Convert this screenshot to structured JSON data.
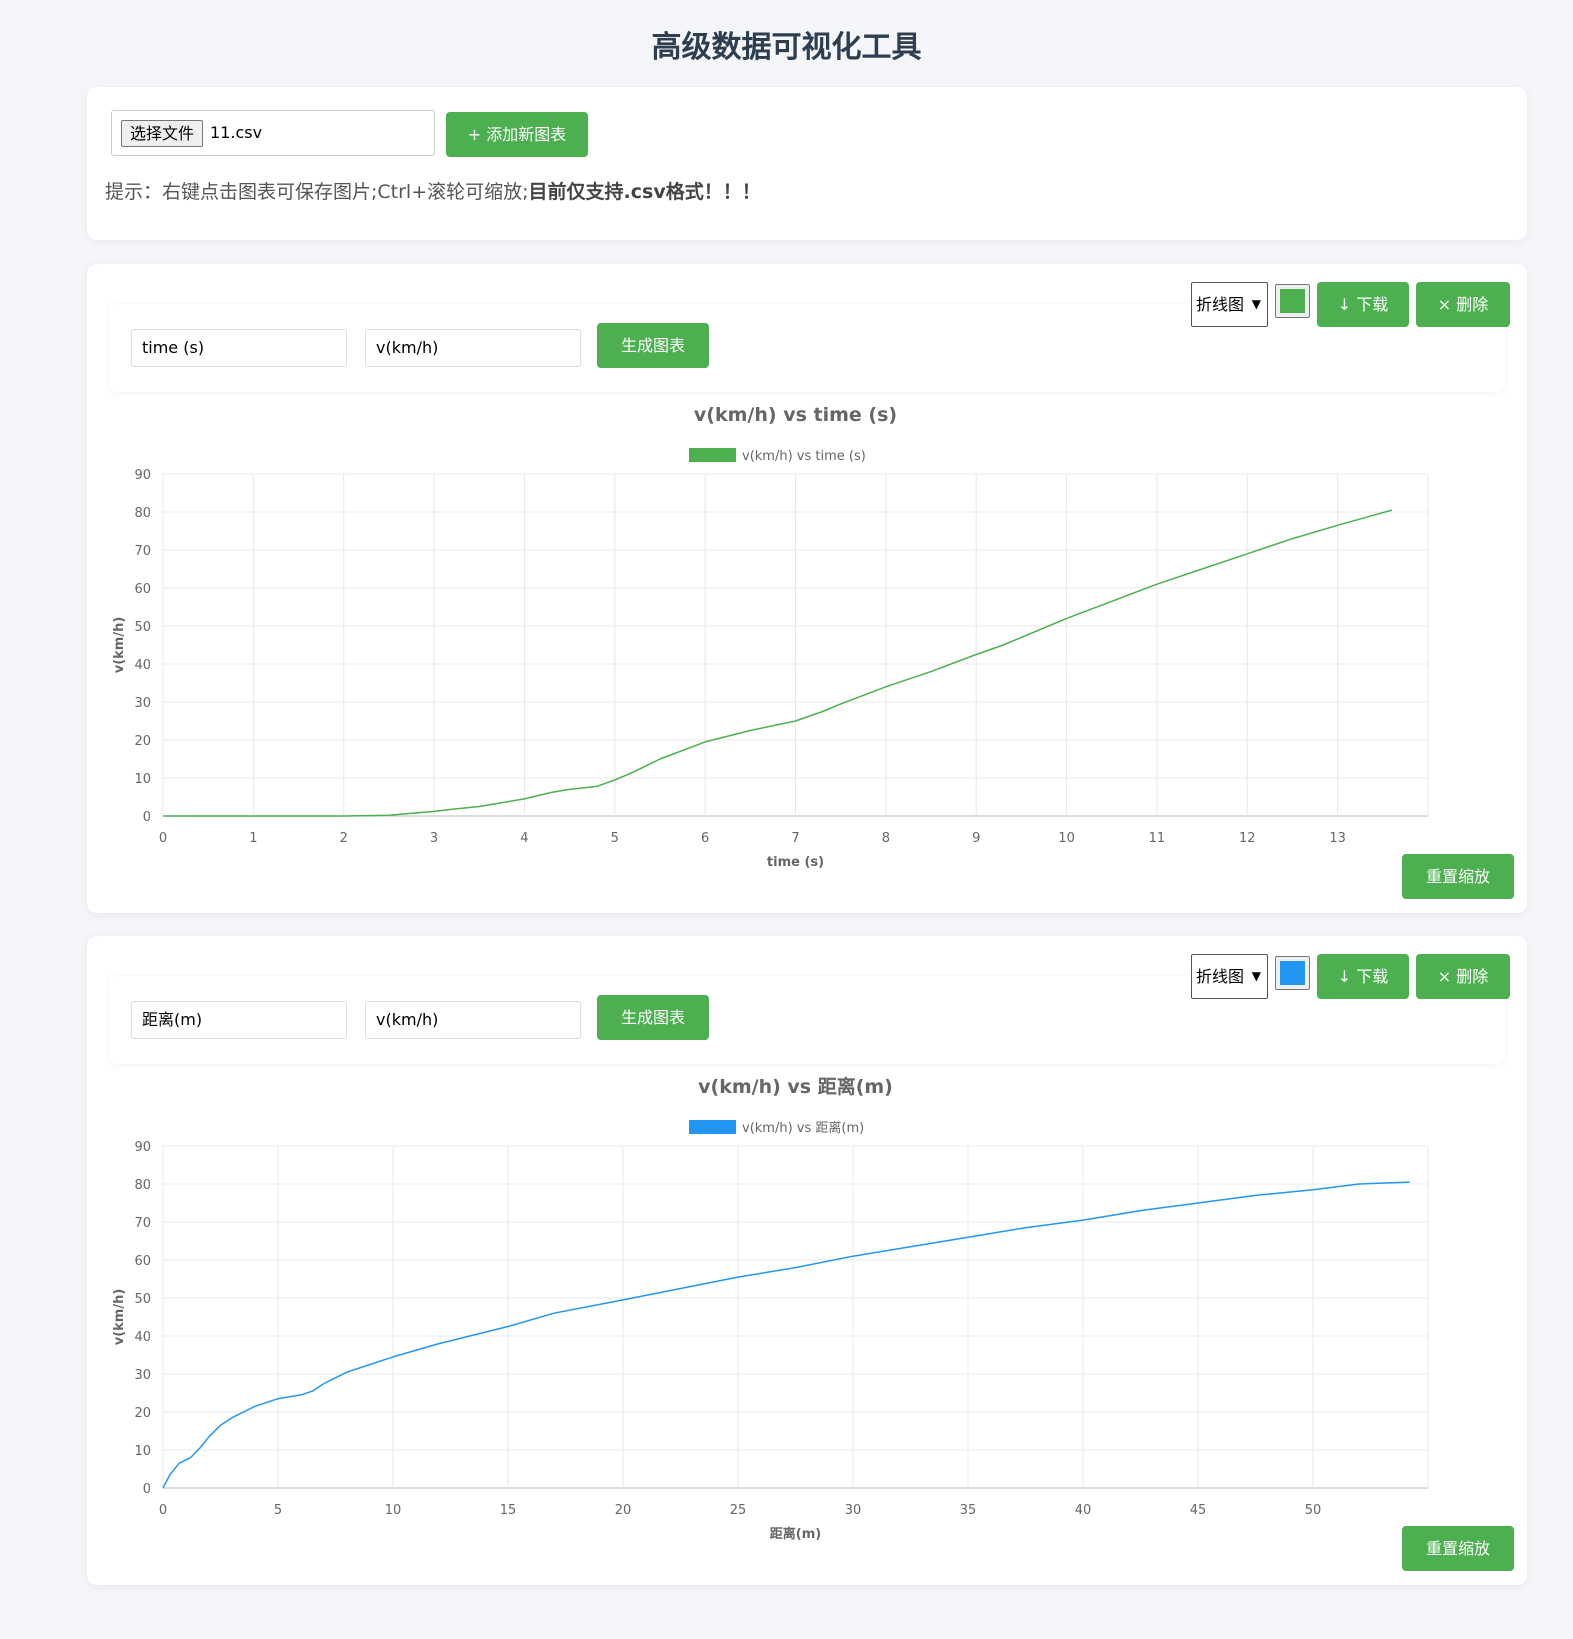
{
  "page": {
    "title": "高级数据可视化工具"
  },
  "upload": {
    "file_button": "选择文件",
    "file_name": "11.csv",
    "add_button": "+ 添加新图表",
    "hint_prefix": "提示：右键点击图表可保存图片;Ctrl+滚轮可缩放;",
    "hint_bold": "目前仅支持.csv格式！！！"
  },
  "charts": [
    {
      "x_input": "time (s)",
      "y_input": "v(km/h)",
      "generate_button": "生成图表",
      "chart_type": "折线图",
      "color": "#4caf50",
      "download_button": "↓ 下载",
      "delete_button": "× 删除",
      "reset_button": "重置缩放"
    },
    {
      "x_input": "距离(m)",
      "y_input": "v(km/h)",
      "generate_button": "生成图表",
      "chart_type": "折线图",
      "color": "#2196f3",
      "download_button": "↓ 下载",
      "delete_button": "× 删除",
      "reset_button": "重置缩放"
    }
  ],
  "chart_data": [
    {
      "type": "line",
      "title": "v(km/h) vs time (s)",
      "xlabel": "time (s)",
      "ylabel": "v(km/h)",
      "xlim": [
        0,
        14
      ],
      "ylim": [
        0,
        90
      ],
      "x_ticks": [
        "0",
        "1",
        "2",
        "3",
        "4",
        "5",
        "6",
        "7",
        "8",
        "9",
        "10",
        "11",
        "12",
        "13"
      ],
      "y_ticks": [
        "0",
        "10",
        "20",
        "30",
        "40",
        "50",
        "60",
        "70",
        "80",
        "90"
      ],
      "grid": true,
      "legend": "top-center",
      "series": [
        {
          "name": "v(km/h) vs time (s)",
          "color": "#4caf50",
          "x": [
            0,
            1,
            2,
            2.5,
            3,
            3.2,
            3.5,
            4,
            4.3,
            4.5,
            4.8,
            5,
            5.2,
            5.5,
            6,
            6.5,
            7,
            7.3,
            7.5,
            8,
            8.5,
            9,
            9.3,
            9.5,
            10,
            10.5,
            11,
            11.5,
            12,
            12.5,
            13,
            13.3,
            13.6
          ],
          "y": [
            0,
            0,
            0,
            0.2,
            1.2,
            1.8,
            2.5,
            4.5,
            6.2,
            7,
            7.8,
            9.5,
            11.5,
            15,
            19.5,
            22.5,
            25,
            27.5,
            29.5,
            34,
            38,
            42.5,
            45,
            47,
            52,
            56.5,
            61,
            65,
            69,
            73,
            76.5,
            78.5,
            80.5
          ]
        }
      ]
    },
    {
      "type": "line",
      "title": "v(km/h) vs 距离(m)",
      "xlabel": "距离(m)",
      "ylabel": "v(km/h)",
      "xlim": [
        0,
        55
      ],
      "ylim": [
        0,
        90
      ],
      "x_ticks": [
        "0",
        "5",
        "10",
        "15",
        "20",
        "25",
        "30",
        "35",
        "40",
        "45",
        "50"
      ],
      "y_ticks": [
        "0",
        "10",
        "20",
        "30",
        "40",
        "50",
        "60",
        "70",
        "80",
        "90"
      ],
      "grid": true,
      "legend": "top-center",
      "series": [
        {
          "name": "v(km/h) vs 距离(m)",
          "color": "#2196f3",
          "x": [
            0,
            0.3,
            0.7,
            1.2,
            1.6,
            2,
            2.5,
            3,
            4,
            5,
            6,
            6.5,
            7,
            8,
            10,
            12,
            15,
            17,
            20,
            22.5,
            25,
            27.5,
            30,
            32.5,
            35,
            37.5,
            40,
            42.5,
            45,
            47.5,
            50,
            52,
            54.2
          ],
          "y": [
            0,
            3.5,
            6.5,
            8,
            10.5,
            13.5,
            16.5,
            18.5,
            21.5,
            23.5,
            24.5,
            25.5,
            27.5,
            30.5,
            34.5,
            38,
            42.5,
            46,
            49.5,
            52.5,
            55.5,
            58,
            61,
            63.5,
            66,
            68.5,
            70.5,
            73,
            75,
            77,
            78.5,
            80,
            80.5
          ]
        }
      ]
    }
  ]
}
